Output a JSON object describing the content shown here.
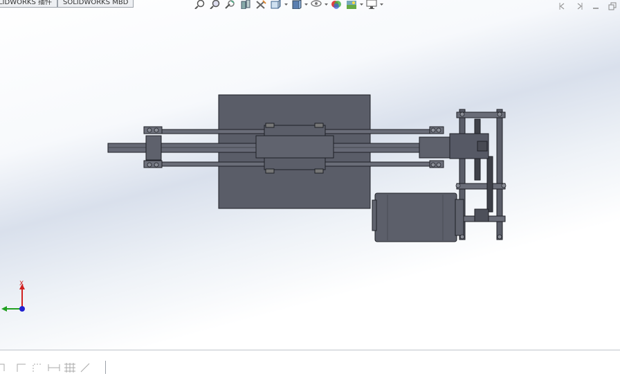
{
  "tabs": [
    {
      "label": "SOLIDWORKS 插件"
    },
    {
      "label": "SOLIDWORKS MBD"
    }
  ],
  "heads_up_toolbar": {
    "icons": [
      "zoom-to-fit-icon",
      "zoom-to-area-icon",
      "previous-view-icon",
      "section-view-icon",
      "dynamic-annotation-icon",
      "view-orientation-icon",
      "display-style-icon",
      "hide-show-items-icon",
      "edit-appearance-icon",
      "apply-scene-icon",
      "view-settings-icon"
    ]
  },
  "triad": {
    "x_label": "X"
  },
  "colors": {
    "model_fill": "#5c5f6a",
    "model_edge": "#1e2026",
    "triad_x": "#d02020",
    "triad_y": "#20a020",
    "triad_z": "#2020d0"
  }
}
